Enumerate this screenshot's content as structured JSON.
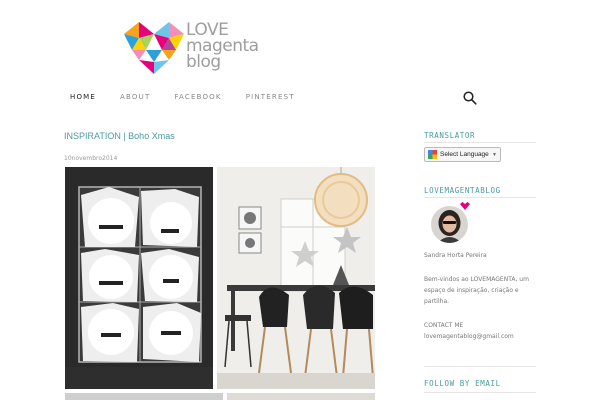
{
  "logo": {
    "line1": "LOVE",
    "line2": "magenta",
    "line3": "blog"
  },
  "nav": {
    "items": [
      {
        "label": "HOME",
        "active": true
      },
      {
        "label": "ABOUT",
        "active": false
      },
      {
        "label": "FACEBOOK",
        "active": false
      },
      {
        "label": "PINTEREST",
        "active": false
      }
    ]
  },
  "post": {
    "title": "INSPIRATION | Boho Xmas",
    "date": "10novembro2014"
  },
  "sidebar": {
    "translator_heading": "TRANSLATOR",
    "translate_label": "Select Language",
    "blog_heading": "LOVEMAGENTABLOG",
    "author_name": "Sandra Horta Pereira",
    "bio_line1": "Bem-vindos ao LOVEMAGENTA, um",
    "bio_line2": "espaço de inspiração, criação e",
    "bio_line3": "partilha.",
    "contact_heading": "CONTACT ME",
    "contact_email": "lovemagentablog@gmail.com",
    "follow_heading": "FOLLOW BY EMAIL"
  },
  "colors": {
    "accent": "#4a9ba0",
    "nav_active": "#222222",
    "heart_magenta": "#e6007e"
  }
}
